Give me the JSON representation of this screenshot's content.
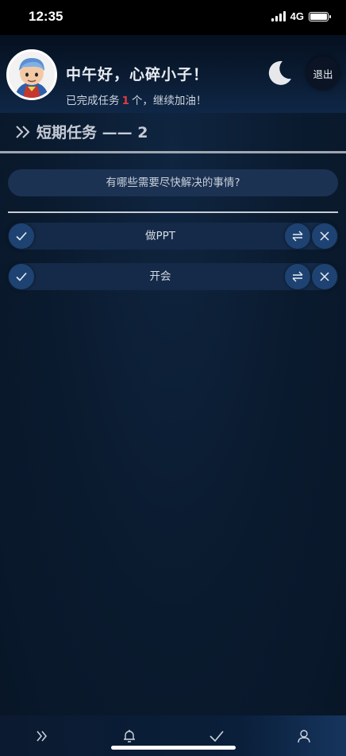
{
  "status_bar": {
    "time": "12:35",
    "network": "4G"
  },
  "header": {
    "greeting": "中午好，心碎小子！",
    "progress_prefix": "已完成任务",
    "completed_count": "1",
    "progress_suffix": "个，继续加油！",
    "logout_label": "退出",
    "theme_icon": "moon-icon"
  },
  "section": {
    "title": "短期任务 —— 2"
  },
  "input": {
    "placeholder": "有哪些需要尽快解决的事情?"
  },
  "tasks": [
    {
      "label": "做PPT"
    },
    {
      "label": "开会"
    }
  ],
  "bottom_nav": {
    "items": [
      "chevrons-right-icon",
      "bell-icon",
      "check-icon",
      "user-icon"
    ]
  },
  "colors": {
    "accent_count": "#e23b3b",
    "row_bg": "#142a48",
    "button_bg": "#1e4372"
  }
}
